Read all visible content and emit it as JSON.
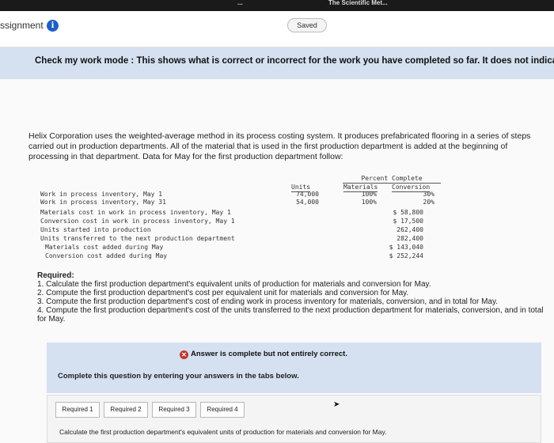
{
  "header": {
    "title": "ssignment",
    "info_icon": "info-icon",
    "saved_label": "Saved",
    "top_tab_1": "...",
    "top_tab_2": "The Scientific Met..."
  },
  "banner": {
    "text": "Check my work mode : This shows what is correct or incorrect for the work you have completed so far. It does not indicate co"
  },
  "problem": {
    "intro": "Helix Corporation uses the weighted-average method in its process costing system. It produces prefabricated flooring in a series of steps carried out in production departments. All of the material that is used in the first production department is added at the beginning of processing in that department. Data for May for the first production department follow:"
  },
  "data_table": {
    "percent_complete_header": "Percent Complete",
    "col_units": "Units",
    "col_materials": "Materials",
    "col_conversion": "Conversion",
    "rows": [
      {
        "label": "Work in process inventory, May 1",
        "units": "74,000",
        "materials": "100%",
        "conversion": "30%",
        "amount": ""
      },
      {
        "label": "Work in process inventory, May 31",
        "units": "54,000",
        "materials": "100%",
        "conversion": "20%",
        "amount": ""
      },
      {
        "label": "Materials cost in work in process inventory, May 1",
        "units": "",
        "materials": "",
        "conversion": "",
        "amount": "$ 58,800"
      },
      {
        "label": "Conversion cost in work in process inventory, May 1",
        "units": "",
        "materials": "",
        "conversion": "",
        "amount": "$ 17,500"
      },
      {
        "label": "Units started into production",
        "units": "",
        "materials": "",
        "conversion": "",
        "amount": "262,400"
      },
      {
        "label": "Units transferred to the next production department",
        "units": "",
        "materials": "",
        "conversion": "",
        "amount": "282,400"
      },
      {
        "label": "Materials cost added during May",
        "units": "",
        "materials": "",
        "conversion": "",
        "amount": "$ 143,040"
      },
      {
        "label": "Conversion cost added during May",
        "units": "",
        "materials": "",
        "conversion": "",
        "amount": "$ 252,244"
      }
    ]
  },
  "required": {
    "heading": "Required:",
    "items": [
      "1. Calculate the first production department's equivalent units of production for materials and conversion for May.",
      "2. Compute the first production department's cost per equivalent unit for materials and conversion for May.",
      "3. Compute the first production department's cost of ending work in process inventory for materials, conversion, and in total for May.",
      "4. Compute the first production department's cost of the units transferred to the next production department for materials, conversion, and in total for May."
    ]
  },
  "answer": {
    "status": "Answer is complete but not entirely correct.",
    "instructions": "Complete this question by entering your answers in the tabs below."
  },
  "tabs": {
    "items": [
      "Required 1",
      "Required 2",
      "Required 3",
      "Required 4"
    ],
    "active_description": "Calculate the first production department's equivalent units of production for materials and conversion for May."
  }
}
